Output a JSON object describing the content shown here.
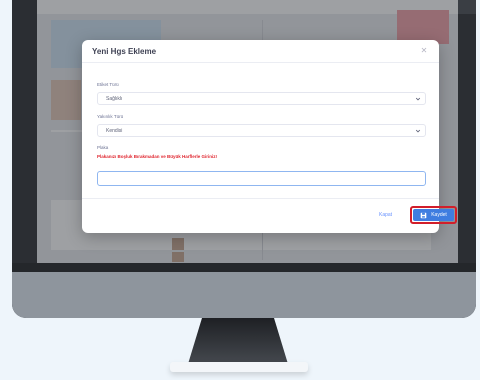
{
  "modal": {
    "title": "Yeni Hgs Ekleme",
    "close_icon": "close-icon",
    "fields": [
      {
        "label": "Etiket Türü",
        "value": "Sağlıklı"
      },
      {
        "label": "Yakınlık Türü",
        "value": "Kendisi"
      }
    ],
    "plate": {
      "label": "Plaka",
      "error": "Plakanızı Boşluk Bırakmadan ve Büyük Harflerle Giriniz!",
      "value": ""
    },
    "buttons": {
      "cancel": "Kapat",
      "save": "Kaydet"
    }
  },
  "colors": {
    "primary": "#3f7de0",
    "error": "#e0262f",
    "highlight": "#d21e2a",
    "monitor": "#2b2e33"
  }
}
